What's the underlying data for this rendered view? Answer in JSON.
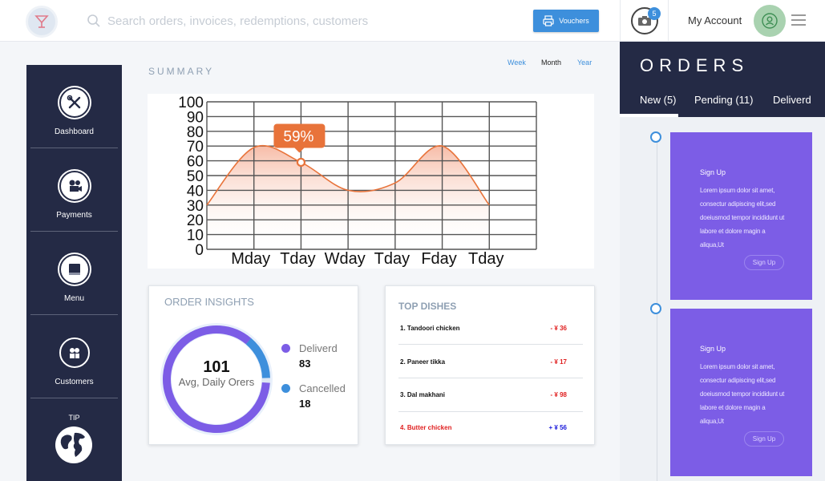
{
  "search": {
    "placeholder": "Search orders, invoices, redemptions, customers"
  },
  "toolbar": {
    "vouchers_label": "Vouchers"
  },
  "header": {
    "notification_count": "5",
    "account_label": "My Account"
  },
  "sidebar": {
    "items": [
      {
        "label": "Dashboard",
        "icon": "tools-icon"
      },
      {
        "label": "Payments",
        "icon": "film-camera-icon"
      },
      {
        "label": "Menu",
        "icon": "book-icon"
      },
      {
        "label": "Customers",
        "icon": "users-icon"
      }
    ],
    "tip_label": "TIP"
  },
  "summary": {
    "title": "SUMMARY",
    "periods": [
      "Week",
      "Month",
      "Year"
    ],
    "active_period": "Month"
  },
  "chart_data": {
    "type": "area",
    "categories": [
      "Mday",
      "Tday",
      "Wday",
      "Tday",
      "Fday",
      "Tday"
    ],
    "x": [
      0,
      1,
      2,
      3,
      4,
      5,
      6
    ],
    "values": [
      30,
      69,
      59,
      40,
      45,
      70,
      30
    ],
    "yticks": [
      "0",
      "10",
      "20",
      "30",
      "40",
      "50",
      "60",
      "70",
      "80",
      "90",
      "100"
    ],
    "ylim": [
      0,
      100
    ],
    "xlim": [
      0,
      7
    ],
    "callout": {
      "label": "59%",
      "x": 2,
      "y": 59
    },
    "grid": true,
    "line_color": "#e8733a"
  },
  "insights": {
    "title": "ORDER INSIGHTS",
    "total": "101",
    "subtitle": "Avg, Daily Orers",
    "donut": {
      "primary_fraction": 0.85,
      "primary_color": "#7c5de6",
      "secondary_color": "#3d8fdc"
    },
    "legend": [
      {
        "name": "Deliverd",
        "value": "83",
        "color": "#7c5de6"
      },
      {
        "name": "Cancelled",
        "value": "18",
        "color": "#3d8fdc"
      }
    ]
  },
  "dishes": {
    "title": "TOP DISHES",
    "items": [
      {
        "name": "1. Tandoori chicken",
        "price": "- ¥ 36",
        "name_color": "#111",
        "price_color": "#e02020"
      },
      {
        "name": "2. Paneer tikka",
        "price": "- ¥ 17",
        "name_color": "#111",
        "price_color": "#e02020"
      },
      {
        "name": "3. Dal makhani",
        "price": "- ¥ 98",
        "name_color": "#111",
        "price_color": "#e02020"
      },
      {
        "name": "4. Butter chicken",
        "price": "+ ¥ 56",
        "name_color": "#e02020",
        "price_color": "#1a1adb"
      }
    ]
  },
  "orders": {
    "title": "ORDERS",
    "tabs": [
      {
        "label": "New  (5)"
      },
      {
        "label": "Pending  (11)"
      },
      {
        "label": "Deliverd"
      }
    ],
    "cards": [
      {
        "title": "Sign Up",
        "text": "Lorem ipsum dolor sit amet, consectur adipiscing elit,sed doeiusmod tempor incididunt ut labore et dolore magin a aliqua,Ut",
        "button": "Sign Up"
      },
      {
        "title": "Sign Up",
        "text": "Lorem ipsum dolor sit amet, consectur adipiscing elit,sed doeiusmod tempor incididunt ut labore et dolore magin a aliqua,Ut",
        "button": "Sign Up"
      }
    ]
  },
  "colors": {
    "sidebar": "#242a45",
    "accent": "#3d8fdc",
    "card_purple": "#7c5de6"
  }
}
